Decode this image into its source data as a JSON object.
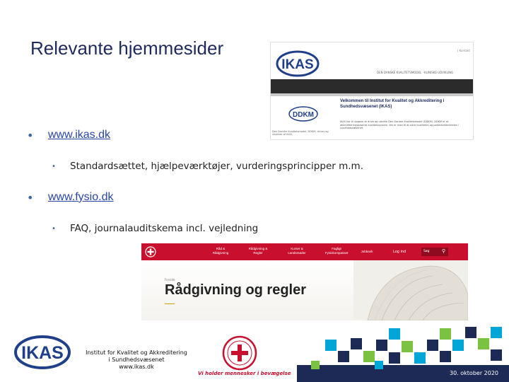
{
  "slide": {
    "title": "Relevante hjemmesider"
  },
  "bullets": [
    {
      "link": "www.ikas.dk",
      "sub": "Standardsættet, hjælpeværktøjer, vurderingsprincipper m.m."
    },
    {
      "link": "www.fysio.dk",
      "sub": "FAQ, journalauditskema incl. vejledning"
    }
  ],
  "ikas_screenshot": {
    "logo_text": "IKAS",
    "lang": "| Kontakt",
    "nav": "DEN DANSKE KVALITETSMODEL   ·   KLINISKE UDVIKLING",
    "ddkm_text": "DDKM",
    "ddkm_caption": "Den Danske Kvalitetsmodel, DDKM, drives og udvikles af IKAS.",
    "welcome": "Velkommen til Institut for Kvalitet og Akkreditering i Sundhedsvæsenet (IKAS)",
    "paragraph": "IKAS har til opgave at drive og udvikle Den Danske Kvalitetsmodel (DDKM). DDKM er et akkrediteringsbaseret kvalitetssystem, der er med til at sikre kvaliteten og patientsikkerheden i sundhedsvæsenet."
  },
  "fysio_screenshot": {
    "nav": [
      {
        "line1": "Råd &",
        "line2": "Rådgivning"
      },
      {
        "line1": "Rådgivning &",
        "line2": "Regler"
      },
      {
        "line1": "Kurser &",
        "line2": "Landsmøder"
      },
      {
        "line1": "Fagligt",
        "line2": "Fysiokompasset"
      },
      {
        "line1": "Jobbank",
        "line2": ""
      }
    ],
    "login": "Log ind",
    "search": "Søg",
    "breadcrumb": "Forside",
    "heading": "Rådgivning og regler"
  },
  "footer": {
    "logo_text": "IKAS",
    "org_line1": "Institut for Kvalitet og Akkreditering",
    "org_line2": "i Sundhedsvæsenet",
    "org_line3": "www.ikas.dk",
    "tagline": "Vi holder mennesker i bevægelse",
    "date": "30. oktober 2020"
  },
  "colors": {
    "title": "#1f2a5c",
    "link": "#2a45a8",
    "ikas_blue": "#1f3f8a",
    "fysio_red": "#c8102e",
    "mosaic_dark": "#1c2a55",
    "mosaic_green": "#7cc242",
    "mosaic_cyan": "#00a6d6"
  }
}
